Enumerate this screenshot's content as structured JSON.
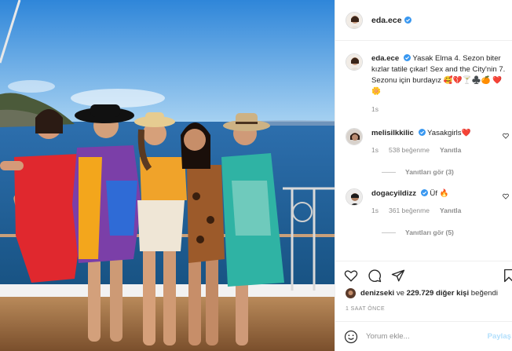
{
  "post": {
    "username": "eda.ece",
    "caption_text": "Yasak Elma 4. Sezon biter kızlar tatile çıkar! Sex and the City'nin 7. Sezonu için burdayız 🥰💔🍸♣️🍊 ❤️🌼",
    "caption_time": "1s"
  },
  "comments": [
    {
      "username": "melisilkkilic",
      "text": "Yasakgirls❤️",
      "time": "1s",
      "likes": "538 beğenme",
      "reply_label": "Yanıtla",
      "view_replies": "Yanıtları gör (3)"
    },
    {
      "username": "dogacyildizz",
      "text": "Üf 🔥",
      "time": "1s",
      "likes": "361 beğenme",
      "reply_label": "Yanıtla",
      "view_replies": "Yanıtları gör (5)"
    }
  ],
  "liked_by": {
    "username": "denizseki",
    "connector": " ve ",
    "count_text": "229.729 diğer kişi",
    "suffix": " beğendi"
  },
  "timestamp": "1 SAAT ÖNCE",
  "add_comment": {
    "placeholder": "Yorum ekle...",
    "post_label": "Paylaş"
  },
  "colors": {
    "verified": "#3897f0",
    "link_blue_disabled": "#b2dffc",
    "sky": "#3f8fd6",
    "sea": "#1d5f9b"
  },
  "icons": [
    "verified-icon",
    "heart-icon",
    "comment-icon",
    "share-icon",
    "bookmark-icon",
    "smile-icon"
  ]
}
